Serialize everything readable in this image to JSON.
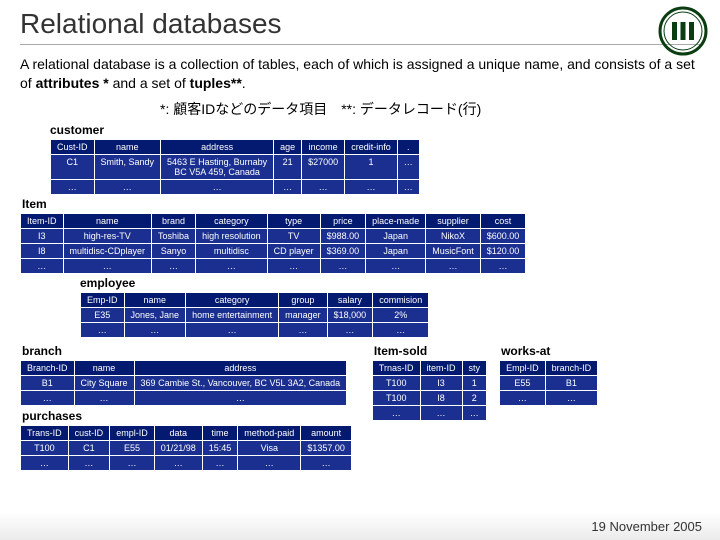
{
  "title": "Relational databases",
  "body": "A relational database is a collection of tables, each of which is assigned a unique name, and consists of a set of ",
  "body_bold1": "attributes *",
  "body_mid": " and a set of ",
  "body_bold2": "tuples**",
  "body_end": ".",
  "note": "*: 顧客IDなどのデータ項目　**: データレコード(行)",
  "footer": "19 November 2005",
  "tables": {
    "customer": {
      "label": "customer",
      "headers": [
        "Cust-ID",
        "name",
        "address",
        "age",
        "income",
        "credit-info",
        "."
      ],
      "rows": [
        [
          "C1",
          "Smith, Sandy",
          "5463 E Hasting, Burnaby\nBC V5A 459, Canada",
          "21",
          "$27000",
          "1",
          "…"
        ],
        [
          "…",
          "…",
          "…",
          "…",
          "…",
          "…",
          "…"
        ]
      ]
    },
    "item": {
      "label": "Item",
      "headers": [
        "Item-ID",
        "name",
        "brand",
        "category",
        "type",
        "price",
        "place-made",
        "supplier",
        "cost"
      ],
      "rows": [
        [
          "I3",
          "high-res-TV",
          "Toshiba",
          "high resolution",
          "TV",
          "$988.00",
          "Japan",
          "NikoX",
          "$600.00"
        ],
        [
          "I8",
          "multidisc-CDplayer",
          "Sanyo",
          "multidisc",
          "CD player",
          "$369.00",
          "Japan",
          "MusicFont",
          "$120.00"
        ],
        [
          "…",
          "…",
          "…",
          "…",
          "…",
          "…",
          "…",
          "…",
          "…"
        ]
      ]
    },
    "employee": {
      "label": "employee",
      "headers": [
        "Emp-ID",
        "name",
        "category",
        "group",
        "salary",
        "commision"
      ],
      "rows": [
        [
          "E35",
          "Jones, Jane",
          "home entertainment",
          "manager",
          "$18,000",
          "2%"
        ],
        [
          "…",
          "…",
          "…",
          "…",
          "…",
          "…"
        ]
      ]
    },
    "branch": {
      "label": "branch",
      "headers": [
        "Branch-ID",
        "name",
        "address"
      ],
      "rows": [
        [
          "B1",
          "City Square",
          "369 Cambie St., Vancouver, BC V5L 3A2, Canada"
        ],
        [
          "…",
          "…",
          "…"
        ]
      ]
    },
    "purchases": {
      "label": "purchases",
      "headers": [
        "Trans-ID",
        "cust-ID",
        "empl-ID",
        "data",
        "time",
        "method-paid",
        "amount"
      ],
      "rows": [
        [
          "T100",
          "C1",
          "E55",
          "01/21/98",
          "15:45",
          "Visa",
          "$1357.00"
        ],
        [
          "…",
          "…",
          "…",
          "…",
          "…",
          "…",
          "…"
        ]
      ]
    },
    "item_sold": {
      "label": "Item-sold",
      "headers": [
        "Trnas-ID",
        "item-ID",
        "sty"
      ],
      "rows": [
        [
          "T100",
          "I3",
          "1"
        ],
        [
          "T100",
          "I8",
          "2"
        ],
        [
          "…",
          "…",
          "…"
        ]
      ]
    },
    "works_at": {
      "label": "works-at",
      "headers": [
        "Empl-ID",
        "branch-ID"
      ],
      "rows": [
        [
          "E55",
          "B1"
        ],
        [
          "…",
          "…"
        ]
      ]
    }
  }
}
